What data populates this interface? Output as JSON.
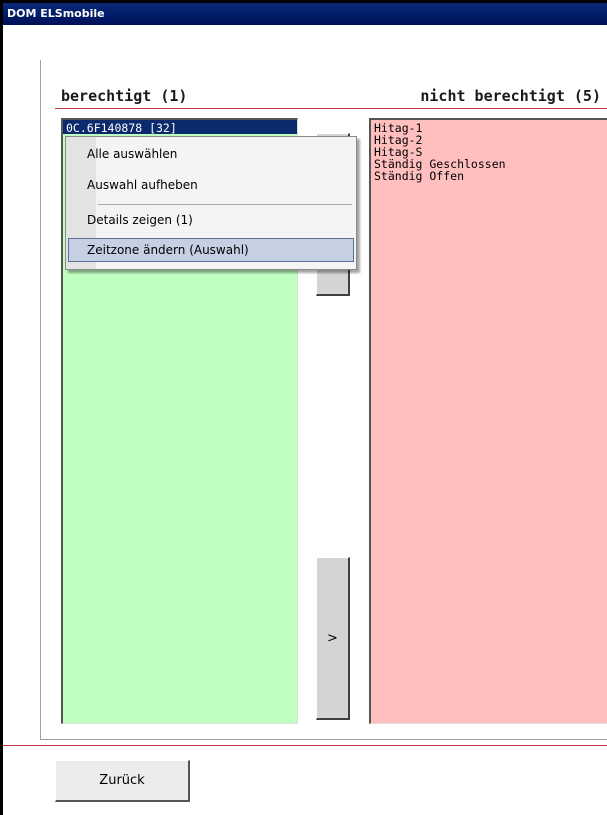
{
  "window": {
    "title": "DOM ELSmobile"
  },
  "panels": {
    "authorized": {
      "heading": "berechtigt (1)",
      "items": [
        "0C.6F140878 [32]"
      ],
      "selected_index": 0
    },
    "not_authorized": {
      "heading": "nicht berechtigt (5)",
      "items": [
        "Hitag-1",
        "Hitag-2",
        "Hitag-S",
        "Ständig Geschlossen",
        "Ständig Offen"
      ]
    }
  },
  "buttons": {
    "move_right_label": ">",
    "move_left_label": "",
    "back_label": "Zurück"
  },
  "context_menu": {
    "items": [
      "Alle auswählen",
      "Auswahl aufheben",
      "Details zeigen (1)",
      "Zeitzone ändern (Auswahl)"
    ],
    "highlighted_index": 3
  },
  "colors": {
    "authorized_bg": "#bfffbf",
    "not_authorized_bg": "#ffbfbf",
    "title_bar": "#001a66",
    "accent_line": "#c0393f"
  }
}
